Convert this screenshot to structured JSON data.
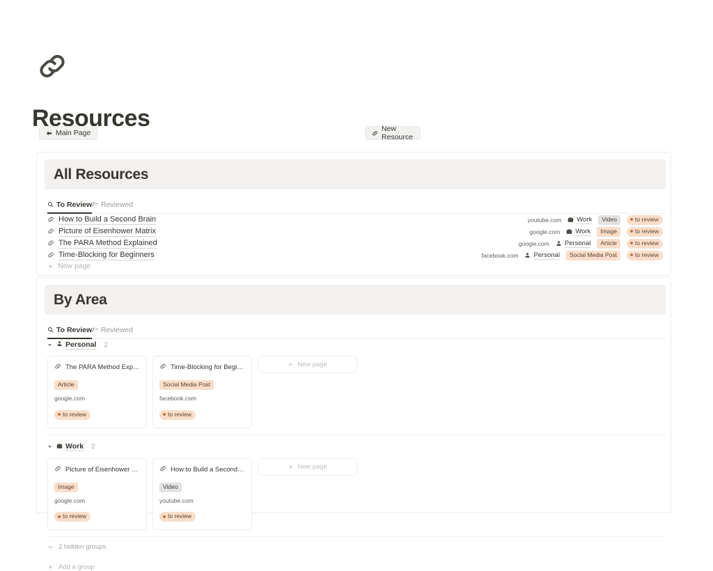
{
  "header": {
    "icon": "link-icon",
    "title": "Resources",
    "buttons": [
      {
        "icon": "arrow-left-icon",
        "label": "Main Page"
      },
      {
        "icon": "link-icon",
        "label": "New Resource"
      }
    ]
  },
  "colors": {
    "tag_orange_bg": "#fadec9",
    "tag_orange_text": "#5b4233",
    "tag_gray_bg": "#e3e2e0",
    "tag_gray_text": "#43413e",
    "status_dot": "#c5714a",
    "banner_bg": "#f2f1ef",
    "text": "#37352f",
    "muted": "#9b9a97"
  },
  "blocks": [
    {
      "id": "all-resources",
      "title": "All Resources",
      "tabs": [
        {
          "icon": "search-icon",
          "label": "To Review",
          "active": true
        },
        {
          "icon": "person-check-icon",
          "label": "Reviewed",
          "active": false
        }
      ],
      "rows": [
        {
          "icon": "link-icon",
          "title": "How to Build a Second Brain",
          "url": "youtube.com",
          "area": "Work",
          "area_icon": "briefcase-icon",
          "type": "Video",
          "type_style": "gray",
          "status": "to review"
        },
        {
          "icon": "link-icon",
          "title": "Picture of Eisenhower Matrix",
          "url": "google.com",
          "area": "Work",
          "area_icon": "briefcase-icon",
          "type": "Image",
          "type_style": "orange",
          "status": "to review"
        },
        {
          "icon": "link-icon",
          "title": "The PARA Method Explained",
          "url": "google.com",
          "area": "Personal",
          "area_icon": "person-icon",
          "type": "Article",
          "type_style": "orange",
          "status": "to review"
        },
        {
          "icon": "link-icon",
          "title": "Time-Blocking for Beginners",
          "url": "facebook.com",
          "area": "Personal",
          "area_icon": "person-icon",
          "type": "Social Media Post",
          "type_style": "orange",
          "status": "to review"
        }
      ],
      "new_page_label": "New page"
    },
    {
      "id": "by-area",
      "title": "By Area",
      "tabs": [
        {
          "icon": "search-icon",
          "label": "To Review",
          "active": true
        },
        {
          "icon": "person-check-icon",
          "label": "Reviewed",
          "active": false
        }
      ],
      "groups": [
        {
          "name": "Personal",
          "icon": "person-icon",
          "count": "2",
          "cards": [
            {
              "icon": "link-icon",
              "title": "The PARA Method Explained",
              "type": "Article",
              "type_style": "orange",
              "url": "google.com",
              "status": "to review"
            },
            {
              "icon": "link-icon",
              "title": "Time-Blocking for Beginners",
              "type": "Social Media Post",
              "type_style": "orange",
              "url": "facebook.com",
              "status": "to review"
            }
          ],
          "new_page_label": "New page"
        },
        {
          "name": "Work",
          "icon": "briefcase-icon",
          "count": "2",
          "cards": [
            {
              "icon": "link-icon",
              "title": "Picture of Eisenhower Matrix",
              "type": "Image",
              "type_style": "orange",
              "url": "google.com",
              "status": "to review"
            },
            {
              "icon": "link-icon",
              "title": "How to Build a Second Brain",
              "type": "Video",
              "type_style": "gray",
              "url": "youtube.com",
              "status": "to review"
            }
          ],
          "new_page_label": "New page"
        }
      ],
      "hidden_groups_label": "2 hidden groups",
      "add_group_label": "Add a group"
    }
  ]
}
